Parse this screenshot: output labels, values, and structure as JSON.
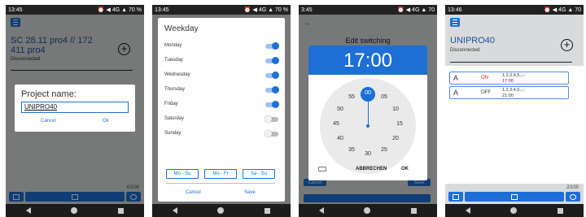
{
  "screen1": {
    "status_time": "13:45",
    "status_right": "⏰ ◀ 4G ▲ 70 %",
    "project_title": "SC 28.11 pro4 // 172 411 pro4",
    "project_status": "Disconnected",
    "counter": "0/100",
    "dialog": {
      "title": "Project name:",
      "input_value": "UNIPRO40",
      "cancel": "Cancel",
      "ok": "Ok"
    }
  },
  "screen2": {
    "status_time": "13:45",
    "status_right": "⏰ ◀ 4G ▲ 70 %",
    "dialog_title": "Weekday",
    "days": [
      {
        "label": "Monday",
        "on": true
      },
      {
        "label": "Tuesday",
        "on": true
      },
      {
        "label": "Wednesday",
        "on": true
      },
      {
        "label": "Thursday",
        "on": true
      },
      {
        "label": "Friday",
        "on": true
      },
      {
        "label": "Saturday",
        "on": false
      },
      {
        "label": "Sunday",
        "on": false
      }
    ],
    "presets": [
      "Mo - Su",
      "Mo - Fr",
      "Sa - Su"
    ],
    "cancel": "Cancel",
    "save": "Save"
  },
  "screen3": {
    "status_time": "3:45",
    "status_right": "⏰ ◀ 4G ▲ 70",
    "screen_title": "Edit switching",
    "time_display": "17:00",
    "clock_numbers": [
      "00",
      "05",
      "10",
      "15",
      "20",
      "25",
      "30",
      "35",
      "40",
      "45",
      "50",
      "55"
    ],
    "cancel": "ABBRECHEN",
    "ok": "OK",
    "bg_cancel": "Cancel",
    "bg_save": "Save"
  },
  "screen4": {
    "status_time": "13:46",
    "status_right": "⏰ ◀ 4G ▲ 70",
    "project_title": "UNIPRO40",
    "project_status": "Disconnected",
    "counter": "2/100",
    "rows": [
      {
        "channel": "A",
        "state": "ON",
        "days": "1,2,3,4,5,-,-",
        "time": "17:00"
      },
      {
        "channel": "A",
        "state": "OFF",
        "days": "1,2,3,4,5,-,-",
        "time": "21:00"
      }
    ]
  },
  "colors": {
    "accent": "#1d6fd6",
    "title_blue": "#1d4f9e",
    "on_red": "#d01818"
  }
}
